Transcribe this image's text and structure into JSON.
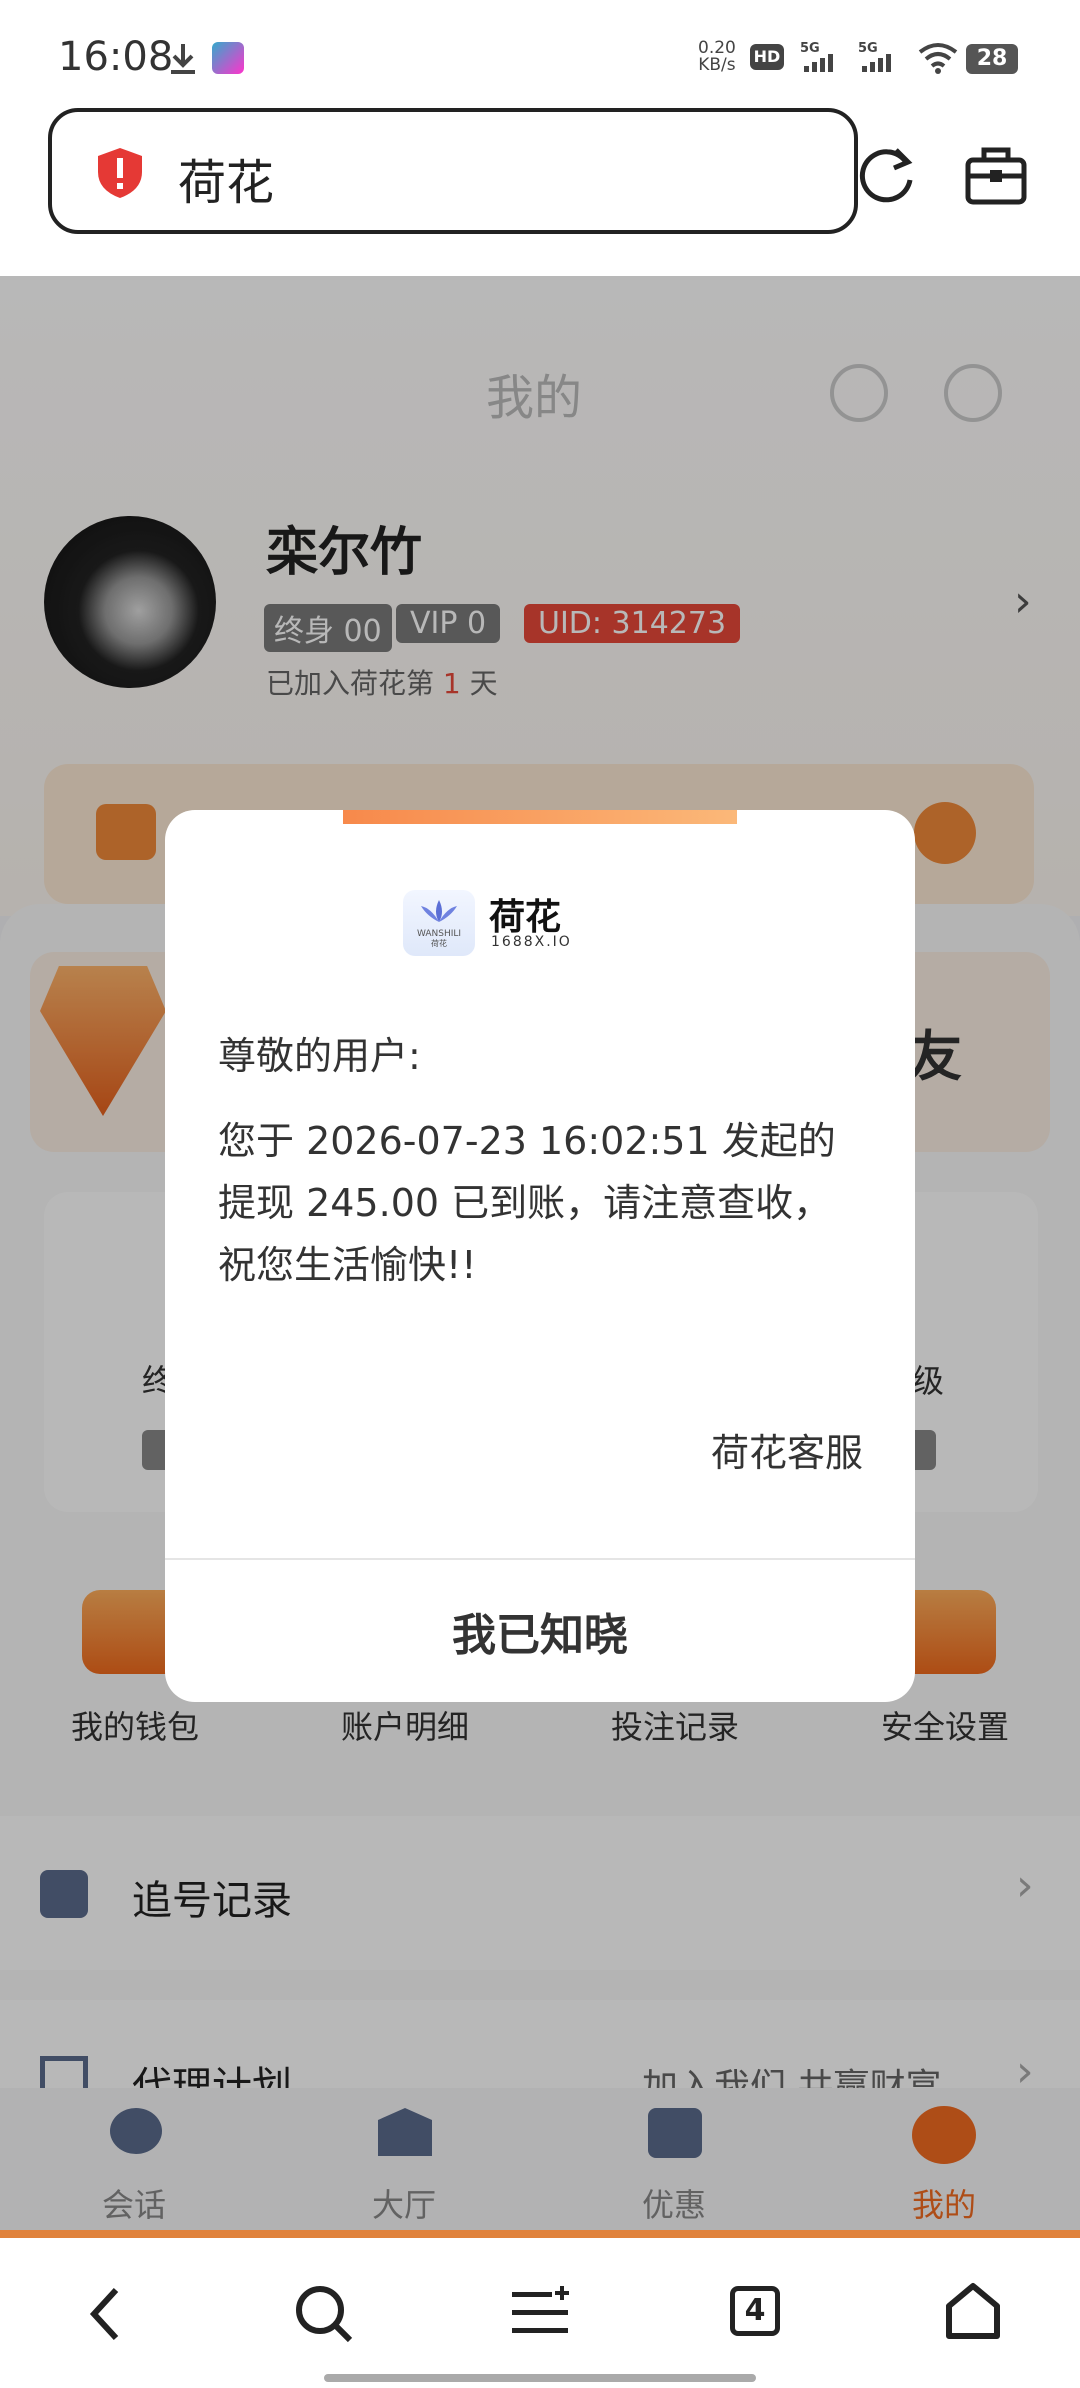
{
  "status_bar": {
    "time": "16:08",
    "net_speed": "0.20",
    "net_unit": "KB/s",
    "battery": "28"
  },
  "browser": {
    "url_text": "荷花"
  },
  "page": {
    "header_title": "我的",
    "username": "栾尔竹",
    "badge_lifetime": "终身 00",
    "badge_vip": "VIP 0",
    "badge_uid": "UID: 314273",
    "join_prefix": "已加入荷花第",
    "join_days": "1",
    "join_suffix": "天",
    "friend_partial": "友",
    "level_partial_left": "终",
    "level_partial_right": "级",
    "shortcuts": [
      "我的钱包",
      "账户明细",
      "投注记录",
      "安全设置"
    ],
    "menu": [
      {
        "label": "追号记录",
        "hint": ""
      },
      {
        "label": "代理计划",
        "hint": "加入我们 共赢财富"
      }
    ]
  },
  "modal": {
    "logo_title": "荷花",
    "logo_sub": "1688X.IO",
    "logo_brand": "WANSHILI",
    "logo_small": "荷花",
    "greeting": "尊敬的用户:",
    "message": "您于 2026-07-23 16:02:51 发起的提现 245.00 已到账，请注意查收，祝您生活愉快!!",
    "signature": "荷花客服",
    "confirm_label": "我已知晓"
  },
  "tabbar": {
    "items": [
      "会话",
      "大厅",
      "优惠",
      "我的"
    ],
    "active": "我的"
  },
  "sys_nav": {
    "tab_count": "4"
  },
  "colors": {
    "accent": "#f26b21",
    "uid_badge": "#e8493a",
    "join_days": "#e8493a",
    "shield": "#e53935"
  }
}
